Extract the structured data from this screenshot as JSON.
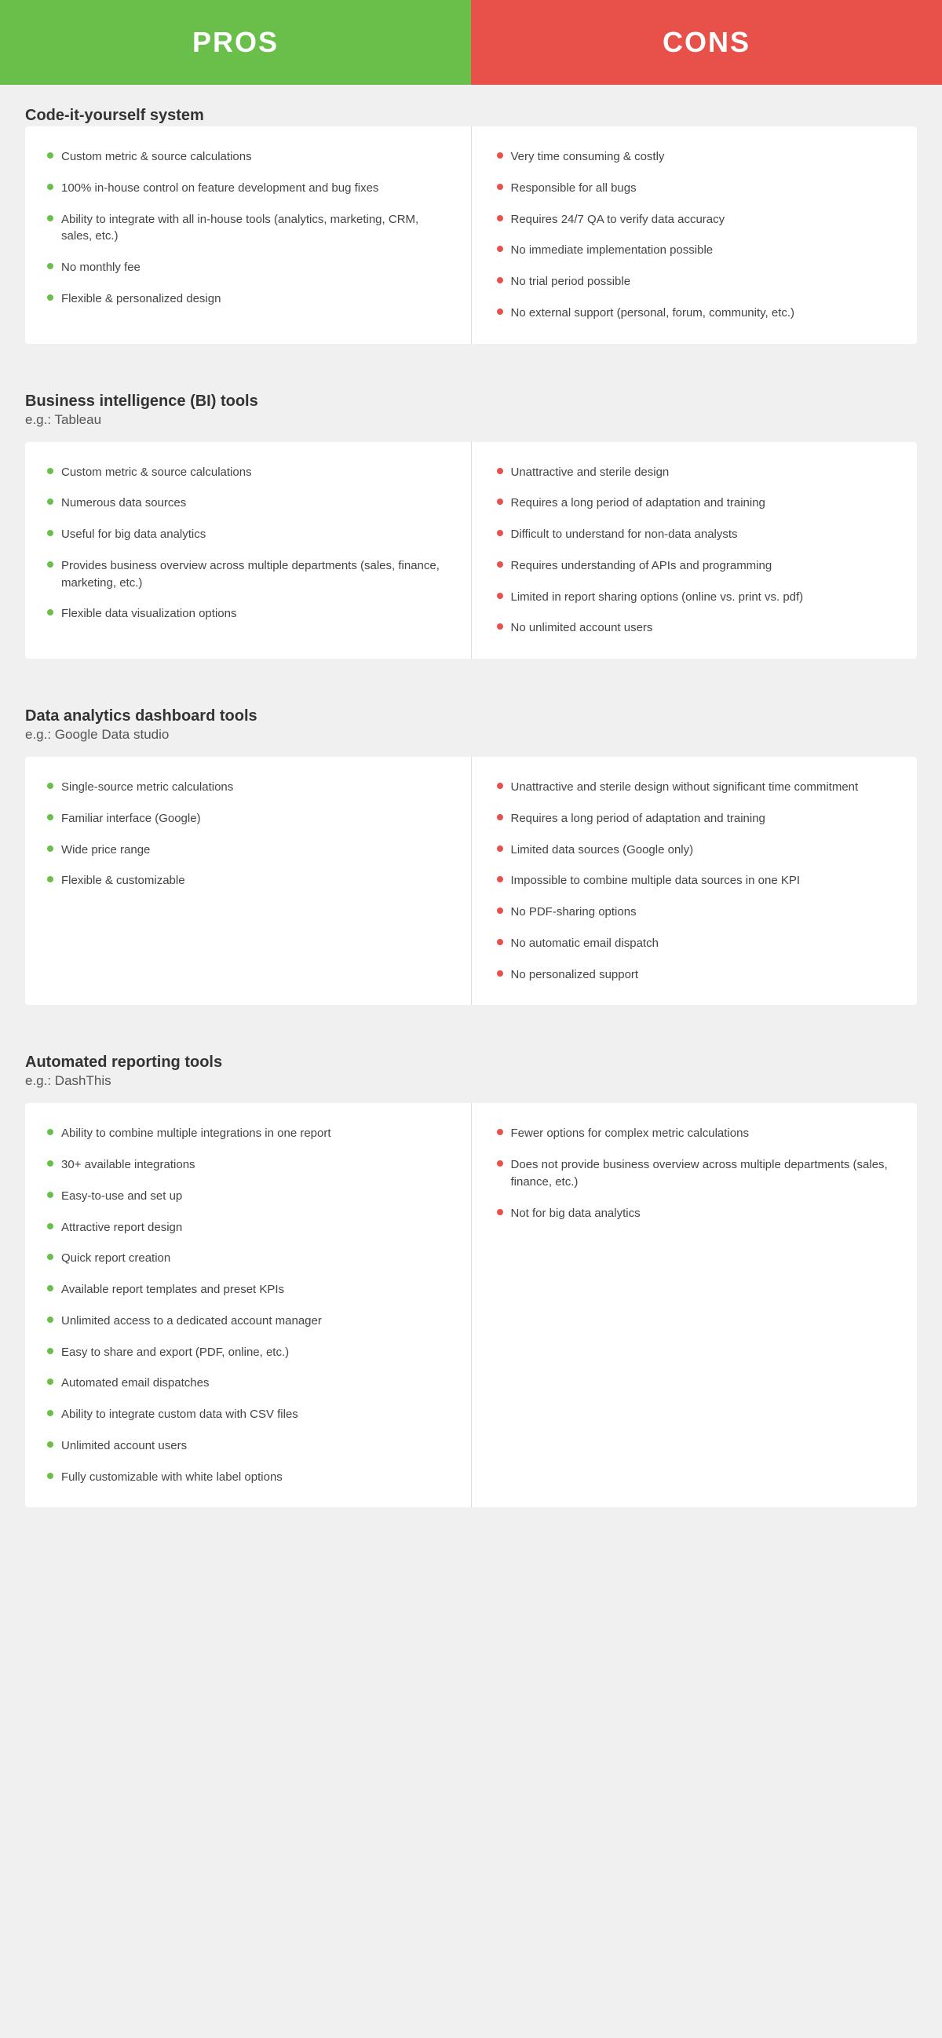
{
  "header": {
    "pros_label": "PROS",
    "cons_label": "CONS"
  },
  "sections": [
    {
      "title": "Code-it-yourself system",
      "subtitle": null,
      "pros": [
        "Custom metric & source calculations",
        "100% in-house control on feature development and bug fixes",
        "Ability to integrate with all in-house tools (analytics, marketing, CRM, sales, etc.)",
        "No monthly fee",
        "Flexible & personalized design"
      ],
      "cons": [
        "Very time consuming & costly",
        "Responsible for all bugs",
        "Requires 24/7 QA to verify data accuracy",
        "No immediate implementation possible",
        "No trial period possible",
        "No external support (personal, forum, community, etc.)"
      ]
    },
    {
      "title": "Business intelligence (BI) tools",
      "subtitle": "e.g.: Tableau",
      "pros": [
        "Custom metric & source calculations",
        "Numerous data sources",
        "Useful for big data analytics",
        "Provides business overview across multiple departments (sales, finance, marketing, etc.)",
        "Flexible data visualization options"
      ],
      "cons": [
        "Unattractive and sterile design",
        "Requires a long period of adaptation and training",
        "Difficult to understand for non-data analysts",
        "Requires understanding of APIs and programming",
        "Limited in report sharing options (online vs. print vs. pdf)",
        "No unlimited account users"
      ]
    },
    {
      "title": "Data analytics dashboard tools",
      "subtitle": "e.g.: Google Data studio",
      "pros": [
        "Single-source metric calculations",
        "Familiar interface (Google)",
        "Wide price range",
        "Flexible & customizable"
      ],
      "cons": [
        "Unattractive and sterile design without significant time commitment",
        "Requires a long period of adaptation and training",
        "Limited data sources (Google only)",
        "Impossible to combine multiple data sources in one KPI",
        "No PDF-sharing options",
        "No automatic email dispatch",
        "No personalized support"
      ]
    },
    {
      "title": "Automated reporting tools",
      "subtitle": "e.g.: DashThis",
      "pros": [
        "Ability to combine multiple integrations in one report",
        "30+ available integrations",
        "Easy-to-use and set up",
        "Attractive report design",
        "Quick report creation",
        "Available report templates and preset KPIs",
        "Unlimited access to a dedicated account manager",
        "Easy to share and export (PDF, online, etc.)",
        "Automated email dispatches",
        "Ability to integrate custom data with CSV files",
        "Unlimited account users",
        "Fully customizable with white label options"
      ],
      "cons": [
        "Fewer options for complex metric calculations",
        "Does not provide business overview across multiple departments (sales, finance, etc.)",
        "Not for big data analytics"
      ]
    }
  ]
}
